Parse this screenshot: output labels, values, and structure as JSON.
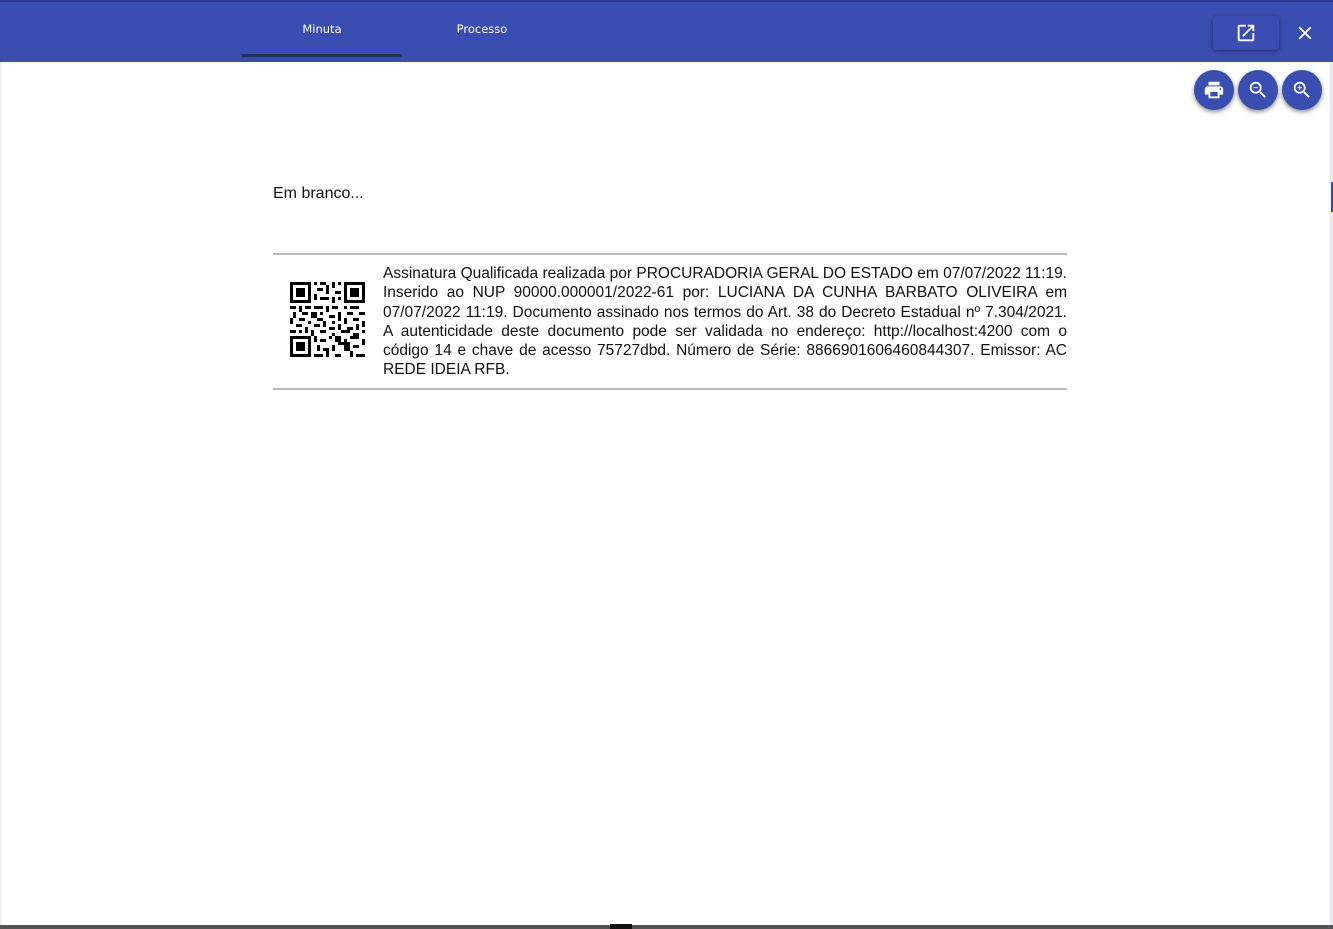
{
  "tabs": [
    {
      "label": "Minuta",
      "active": true
    },
    {
      "label": "Processo",
      "active": false
    }
  ],
  "toolbar": {
    "open_icon": "open-in-new-icon",
    "close_icon": "close-icon",
    "print_icon": "print-icon",
    "zoom_out_icon": "zoom-out-icon",
    "zoom_in_icon": "zoom-in-icon"
  },
  "document": {
    "body_text": "Em branco...",
    "signature_text": "Assinatura Qualificada realizada por PROCURADORIA GERAL DO ESTADO em 07/07/2022 11:19. Inserido ao NUP 90000.000001/2022-61 por: LUCIANA DA CUNHA BARBATO OLIVEIRA em 07/07/2022 11:19. Documento assinado nos termos do Art. 38 do Decreto Estadual nº 7.304/2021. A autenticidade deste documento pode ser validada no endereço: http://localhost:4200 com o código 14 e chave de acesso 75727dbd. Número de Série: 8866901606460844307. Emissor: AC REDE IDEIA RFB."
  },
  "colors": {
    "primary": "#3a4db0",
    "tab_indicator": "#2a2f5a",
    "divider": "#b9b9b9"
  }
}
